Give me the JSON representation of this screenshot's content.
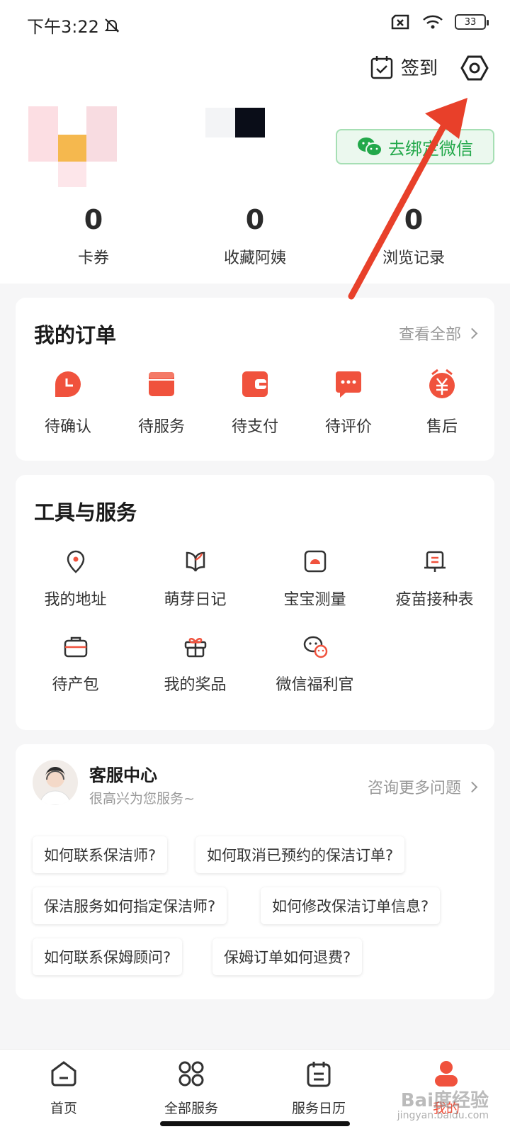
{
  "status_bar": {
    "time": "下午3:22",
    "battery": "33"
  },
  "header": {
    "checkin_label": "签到"
  },
  "profile": {
    "wechat_bind_label": "去绑定微信"
  },
  "stats": [
    {
      "value": "0",
      "label": "卡券"
    },
    {
      "value": "0",
      "label": "收藏阿姨"
    },
    {
      "value": "0",
      "label": "浏览记录"
    }
  ],
  "orders": {
    "title": "我的订单",
    "more": "查看全部",
    "items": [
      {
        "label": "待确认",
        "icon": "clock-icon"
      },
      {
        "label": "待服务",
        "icon": "box-icon"
      },
      {
        "label": "待支付",
        "icon": "wallet-icon"
      },
      {
        "label": "待评价",
        "icon": "chat-icon"
      },
      {
        "label": "售后",
        "icon": "yuan-icon"
      }
    ]
  },
  "tools": {
    "title": "工具与服务",
    "items": [
      {
        "label": "我的地址",
        "icon": "location-icon"
      },
      {
        "label": "萌芽日记",
        "icon": "book-icon"
      },
      {
        "label": "宝宝测量",
        "icon": "scale-icon"
      },
      {
        "label": "疫苗接种表",
        "icon": "calendar-icon"
      },
      {
        "label": "待产包",
        "icon": "bag-icon"
      },
      {
        "label": "我的奖品",
        "icon": "gift-icon"
      },
      {
        "label": "微信福利官",
        "icon": "wechat-icon"
      }
    ]
  },
  "service": {
    "title": "客服中心",
    "subtitle": "很高兴为您服务~",
    "more": "咨询更多问题",
    "faqs": [
      "如何联系保洁师?",
      "如何取消已预约的保洁订单?",
      "保洁服务如何指定保洁师?",
      "如何修改保洁订单信息?",
      "如何联系保姆顾问?",
      "保姆订单如何退费?"
    ]
  },
  "nav": [
    {
      "label": "首页",
      "icon": "home-icon"
    },
    {
      "label": "全部服务",
      "icon": "grid-icon"
    },
    {
      "label": "服务日历",
      "icon": "calendar-icon"
    },
    {
      "label": "我的",
      "icon": "user-icon"
    }
  ],
  "watermark": {
    "text": "Bai度经验",
    "sub": "jingyan.baidu.com"
  },
  "colors": {
    "accent": "#f0523d",
    "wechat": "#22a84a",
    "arrow": "#e8402a"
  }
}
